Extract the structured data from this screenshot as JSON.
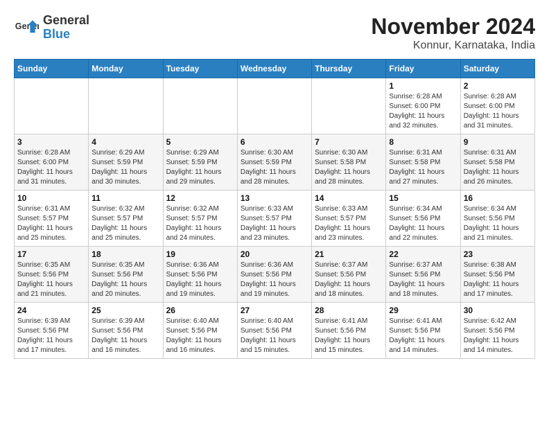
{
  "logo": {
    "text_line1": "General",
    "text_line2": "Blue"
  },
  "title": "November 2024",
  "subtitle": "Konnur, Karnataka, India",
  "weekdays": [
    "Sunday",
    "Monday",
    "Tuesday",
    "Wednesday",
    "Thursday",
    "Friday",
    "Saturday"
  ],
  "weeks": [
    [
      {
        "day": "",
        "info": ""
      },
      {
        "day": "",
        "info": ""
      },
      {
        "day": "",
        "info": ""
      },
      {
        "day": "",
        "info": ""
      },
      {
        "day": "",
        "info": ""
      },
      {
        "day": "1",
        "info": "Sunrise: 6:28 AM\nSunset: 6:00 PM\nDaylight: 11 hours and 32 minutes."
      },
      {
        "day": "2",
        "info": "Sunrise: 6:28 AM\nSunset: 6:00 PM\nDaylight: 11 hours and 31 minutes."
      }
    ],
    [
      {
        "day": "3",
        "info": "Sunrise: 6:28 AM\nSunset: 6:00 PM\nDaylight: 11 hours and 31 minutes."
      },
      {
        "day": "4",
        "info": "Sunrise: 6:29 AM\nSunset: 5:59 PM\nDaylight: 11 hours and 30 minutes."
      },
      {
        "day": "5",
        "info": "Sunrise: 6:29 AM\nSunset: 5:59 PM\nDaylight: 11 hours and 29 minutes."
      },
      {
        "day": "6",
        "info": "Sunrise: 6:30 AM\nSunset: 5:59 PM\nDaylight: 11 hours and 28 minutes."
      },
      {
        "day": "7",
        "info": "Sunrise: 6:30 AM\nSunset: 5:58 PM\nDaylight: 11 hours and 28 minutes."
      },
      {
        "day": "8",
        "info": "Sunrise: 6:31 AM\nSunset: 5:58 PM\nDaylight: 11 hours and 27 minutes."
      },
      {
        "day": "9",
        "info": "Sunrise: 6:31 AM\nSunset: 5:58 PM\nDaylight: 11 hours and 26 minutes."
      }
    ],
    [
      {
        "day": "10",
        "info": "Sunrise: 6:31 AM\nSunset: 5:57 PM\nDaylight: 11 hours and 25 minutes."
      },
      {
        "day": "11",
        "info": "Sunrise: 6:32 AM\nSunset: 5:57 PM\nDaylight: 11 hours and 25 minutes."
      },
      {
        "day": "12",
        "info": "Sunrise: 6:32 AM\nSunset: 5:57 PM\nDaylight: 11 hours and 24 minutes."
      },
      {
        "day": "13",
        "info": "Sunrise: 6:33 AM\nSunset: 5:57 PM\nDaylight: 11 hours and 23 minutes."
      },
      {
        "day": "14",
        "info": "Sunrise: 6:33 AM\nSunset: 5:57 PM\nDaylight: 11 hours and 23 minutes."
      },
      {
        "day": "15",
        "info": "Sunrise: 6:34 AM\nSunset: 5:56 PM\nDaylight: 11 hours and 22 minutes."
      },
      {
        "day": "16",
        "info": "Sunrise: 6:34 AM\nSunset: 5:56 PM\nDaylight: 11 hours and 21 minutes."
      }
    ],
    [
      {
        "day": "17",
        "info": "Sunrise: 6:35 AM\nSunset: 5:56 PM\nDaylight: 11 hours and 21 minutes."
      },
      {
        "day": "18",
        "info": "Sunrise: 6:35 AM\nSunset: 5:56 PM\nDaylight: 11 hours and 20 minutes."
      },
      {
        "day": "19",
        "info": "Sunrise: 6:36 AM\nSunset: 5:56 PM\nDaylight: 11 hours and 19 minutes."
      },
      {
        "day": "20",
        "info": "Sunrise: 6:36 AM\nSunset: 5:56 PM\nDaylight: 11 hours and 19 minutes."
      },
      {
        "day": "21",
        "info": "Sunrise: 6:37 AM\nSunset: 5:56 PM\nDaylight: 11 hours and 18 minutes."
      },
      {
        "day": "22",
        "info": "Sunrise: 6:37 AM\nSunset: 5:56 PM\nDaylight: 11 hours and 18 minutes."
      },
      {
        "day": "23",
        "info": "Sunrise: 6:38 AM\nSunset: 5:56 PM\nDaylight: 11 hours and 17 minutes."
      }
    ],
    [
      {
        "day": "24",
        "info": "Sunrise: 6:39 AM\nSunset: 5:56 PM\nDaylight: 11 hours and 17 minutes."
      },
      {
        "day": "25",
        "info": "Sunrise: 6:39 AM\nSunset: 5:56 PM\nDaylight: 11 hours and 16 minutes."
      },
      {
        "day": "26",
        "info": "Sunrise: 6:40 AM\nSunset: 5:56 PM\nDaylight: 11 hours and 16 minutes."
      },
      {
        "day": "27",
        "info": "Sunrise: 6:40 AM\nSunset: 5:56 PM\nDaylight: 11 hours and 15 minutes."
      },
      {
        "day": "28",
        "info": "Sunrise: 6:41 AM\nSunset: 5:56 PM\nDaylight: 11 hours and 15 minutes."
      },
      {
        "day": "29",
        "info": "Sunrise: 6:41 AM\nSunset: 5:56 PM\nDaylight: 11 hours and 14 minutes."
      },
      {
        "day": "30",
        "info": "Sunrise: 6:42 AM\nSunset: 5:56 PM\nDaylight: 11 hours and 14 minutes."
      }
    ]
  ]
}
